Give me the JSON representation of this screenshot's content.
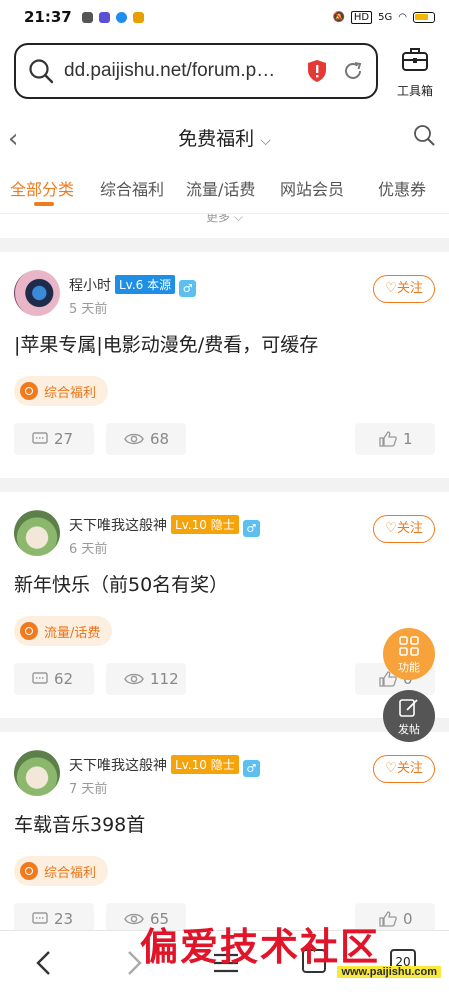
{
  "status_bar": {
    "time": "21:37",
    "network": "5G"
  },
  "browser": {
    "url": "dd.paijishu.net/forum.p…",
    "toolbox_label": "工具箱"
  },
  "header": {
    "title": "免费福利",
    "caret": "⌵"
  },
  "tabs": [
    {
      "label": "全部分类",
      "active": true
    },
    {
      "label": "综合福利"
    },
    {
      "label": "流量/话费"
    },
    {
      "label": "网站会员"
    },
    {
      "label": "优惠券"
    }
  ],
  "more_label": "更多 ⌵",
  "posts": [
    {
      "author": "程小时",
      "level": "Lv.6 本源",
      "level_color": "#1f8fe6",
      "gender": "♂",
      "time": "5 天前",
      "follow": "关注",
      "title": "|苹果专属|电影动漫免/费看，可缓存",
      "tag": "综合福利",
      "comments": "27",
      "views": "68",
      "likes": "1"
    },
    {
      "author": "天下唯我这般神",
      "level": "Lv.10 隐士",
      "level_color": "#f5a30a",
      "gender": "♂",
      "time": "6 天前",
      "follow": "关注",
      "title": "新年快乐（前50名有奖）",
      "tag": "流量/话费",
      "comments": "62",
      "views": "112",
      "likes": "0"
    },
    {
      "author": "天下唯我这般神",
      "level": "Lv.10 隐士",
      "level_color": "#f5a30a",
      "gender": "♂",
      "time": "7 天前",
      "follow": "关注",
      "title": "车载音乐398首",
      "tag": "综合福利",
      "comments": "23",
      "views": "65",
      "likes": "0"
    }
  ],
  "float_buttons": {
    "function": "功能",
    "post": "发帖"
  },
  "bottom_nav": {
    "tabs_count": "20"
  },
  "watermark": {
    "text": "偏爱技术社区",
    "url": "www.paijishu.com"
  },
  "colors": {
    "accent": "#f07b1f",
    "tag_bg": "#fdefe0",
    "link_blue": "#5bc0f0"
  }
}
